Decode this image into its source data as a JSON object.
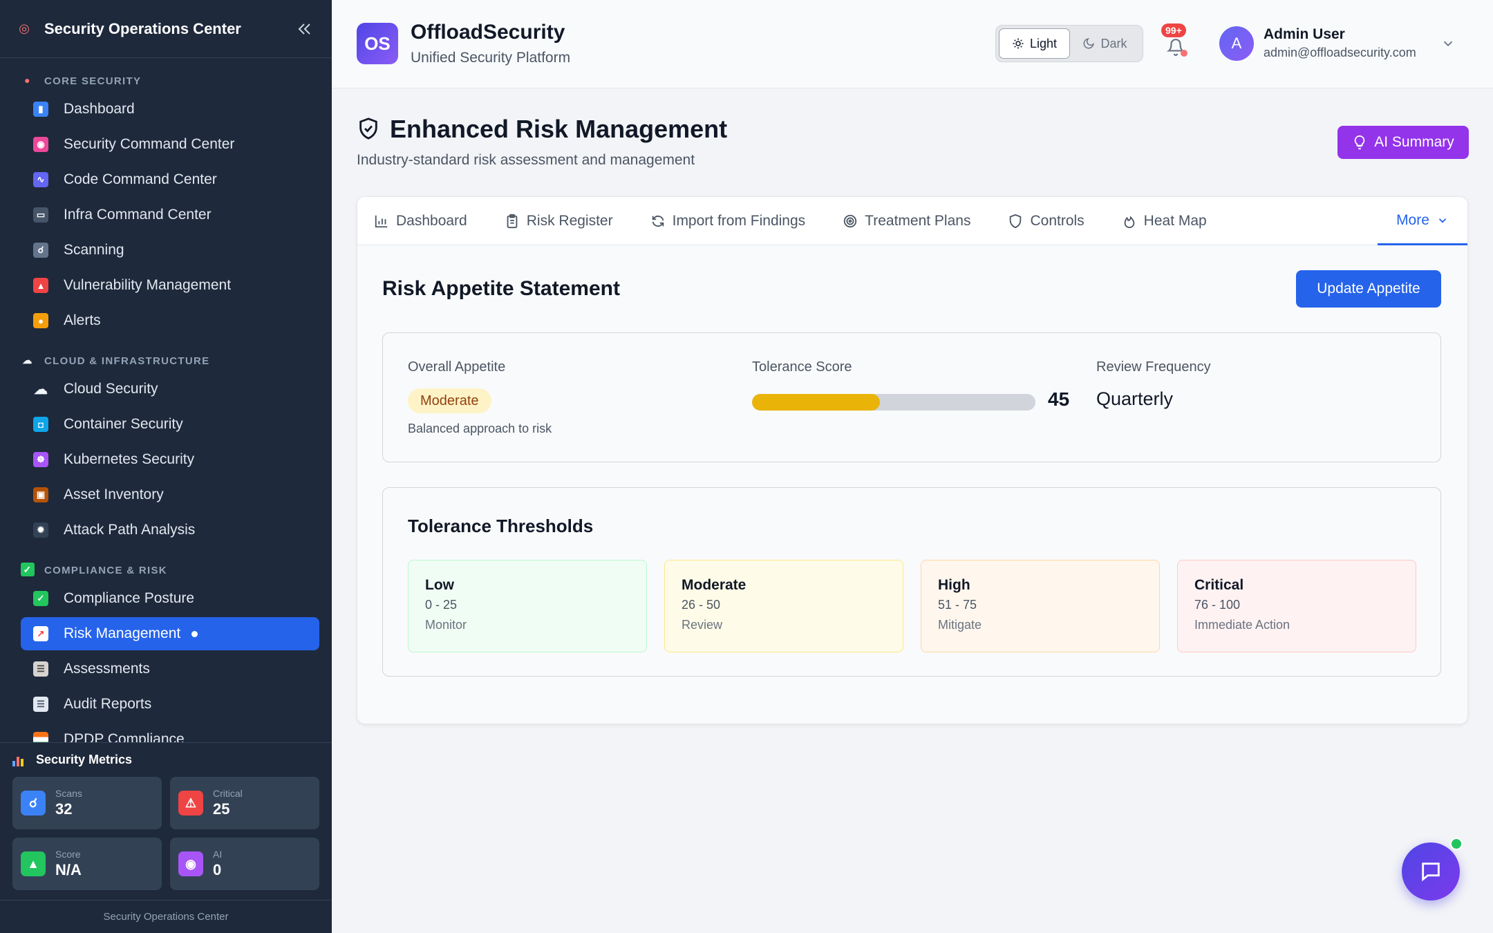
{
  "sidebar": {
    "title": "Security Operations Center",
    "sections": [
      {
        "label": "CORE SECURITY",
        "items": [
          "Dashboard",
          "Security Command Center",
          "Code Command Center",
          "Infra Command Center",
          "Scanning",
          "Vulnerability Management",
          "Alerts"
        ]
      },
      {
        "label": "CLOUD & INFRASTRUCTURE",
        "items": [
          "Cloud Security",
          "Container Security",
          "Kubernetes Security",
          "Asset Inventory",
          "Attack Path Analysis"
        ]
      },
      {
        "label": "COMPLIANCE & RISK",
        "items": [
          "Compliance Posture",
          "Risk Management",
          "Assessments",
          "Audit Reports",
          "DPDP Compliance"
        ]
      }
    ],
    "metrics": {
      "title": "Security Metrics",
      "scans": {
        "label": "Scans",
        "value": "32"
      },
      "critical": {
        "label": "Critical",
        "value": "25"
      },
      "score": {
        "label": "Score",
        "value": "N/A"
      },
      "ai": {
        "label": "AI",
        "value": "0"
      }
    },
    "footer": "Security Operations Center"
  },
  "topbar": {
    "logo_text": "OS",
    "brand": "OffloadSecurity",
    "subtitle": "Unified Security Platform",
    "theme_light": "Light",
    "theme_dark": "Dark",
    "notif_badge": "99+",
    "user_initial": "A",
    "user_name": "Admin User",
    "user_email": "admin@offloadsecurity.com"
  },
  "page": {
    "title": "Enhanced Risk Management",
    "subtitle": "Industry-standard risk assessment and management",
    "ai_summary": "AI Summary"
  },
  "tabs": {
    "dashboard": "Dashboard",
    "register": "Risk Register",
    "import": "Import from Findings",
    "treatment": "Treatment Plans",
    "controls": "Controls",
    "heatmap": "Heat Map",
    "more": "More"
  },
  "appetite": {
    "title": "Risk Appetite Statement",
    "update_button": "Update Appetite",
    "overall_label": "Overall Appetite",
    "overall_value": "Moderate",
    "overall_note": "Balanced approach to risk",
    "tolerance_label": "Tolerance Score",
    "tolerance_value": "45",
    "tolerance_percent": 45,
    "review_label": "Review Frequency",
    "review_value": "Quarterly"
  },
  "thresholds": {
    "title": "Tolerance Thresholds",
    "items": [
      {
        "name": "Low",
        "range": "0 - 25",
        "action": "Monitor",
        "bg": "#f0fdf4",
        "border": "#bbf7d0"
      },
      {
        "name": "Moderate",
        "range": "26 - 50",
        "action": "Review",
        "bg": "#fefce8",
        "border": "#fde68a"
      },
      {
        "name": "High",
        "range": "51 - 75",
        "action": "Mitigate",
        "bg": "#fff7ed",
        "border": "#fed7aa"
      },
      {
        "name": "Critical",
        "range": "76 - 100",
        "action": "Immediate Action",
        "bg": "#fef2f2",
        "border": "#fecaca"
      }
    ]
  }
}
